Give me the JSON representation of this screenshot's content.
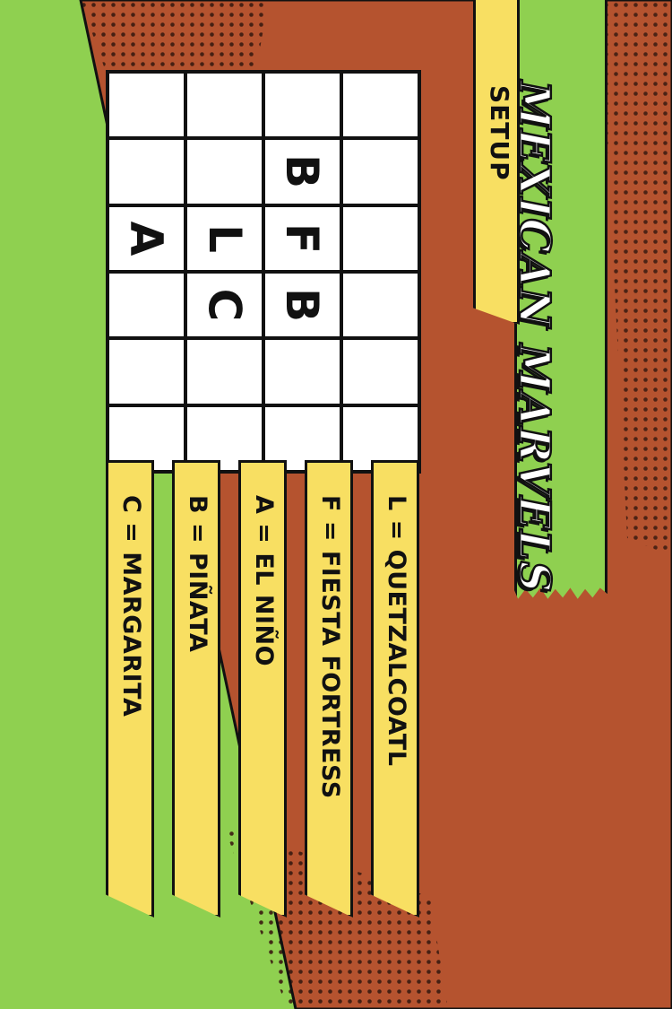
{
  "title": "Mexican Marvels",
  "setup_label": "Setup",
  "colors": {
    "green": "#8fd050",
    "rust": "#b5532f",
    "yellow": "#f8df62",
    "ink": "#111111"
  },
  "grid": {
    "rows": [
      [
        "",
        "",
        "",
        ""
      ],
      [
        "",
        "",
        "B",
        ""
      ],
      [
        "A",
        "L",
        "F",
        ""
      ],
      [
        "",
        "C",
        "B",
        ""
      ],
      [
        "",
        "",
        "",
        ""
      ],
      [
        "",
        "",
        "",
        ""
      ]
    ]
  },
  "legend": [
    "C = Margarita",
    "B = Piñata",
    "A = El Niño",
    "F = Fiesta Fortress",
    "L = Quetzalcoatl"
  ]
}
